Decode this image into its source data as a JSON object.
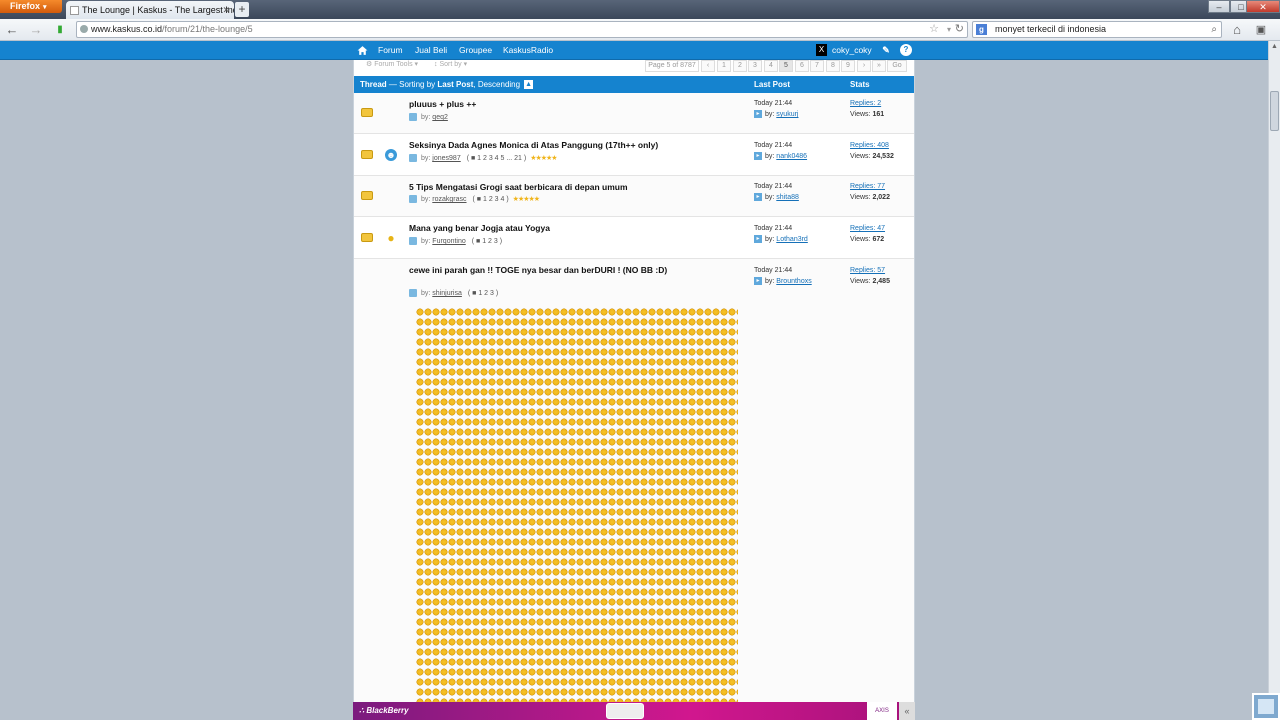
{
  "browser": {
    "menu_button": "Firefox",
    "tab_title": "The Lounge | Kaskus - The Largest Indon...",
    "new_tab": "+",
    "url_domain": "www.kaskus.co.id",
    "url_path": "/forum/21/the-lounge/5",
    "search_engine_glyph": "g",
    "search_query": "monyet terkecil di indonesia",
    "window_buttons": [
      "–",
      "□",
      "✕"
    ]
  },
  "sitenav": {
    "items": [
      "Forum",
      "Jual Beli",
      "Groupee",
      "KaskusRadio"
    ],
    "username": "coky_coky",
    "avatar_glyph": "X"
  },
  "toolbar": {
    "forum_tools": "⚙ Forum Tools ▾",
    "sort_by": "↕ Sort by ▾",
    "page_info": "Page 5 of 8787",
    "prev": "‹",
    "pages": [
      "1",
      "2",
      "3",
      "4",
      "5",
      "6",
      "7",
      "8",
      "9"
    ],
    "current_page": "5",
    "next": "›",
    "last": "»",
    "go": "Go"
  },
  "table_header": {
    "thread_prefix": "Thread",
    "sort_text": " — Sorting by ",
    "sort_field": "Last Post",
    "sort_sep": ", ",
    "sort_dir": "Descending",
    "sort_icon": "▲",
    "last_post": "Last Post",
    "stats": "Stats"
  },
  "threads": [
    {
      "title": "pluuus + plus ++",
      "by_label": "by:",
      "author": "qeq2",
      "pages": "",
      "rating": "",
      "time": "Today 21:44",
      "lp_by_label": "by:",
      "lp_user": "syukurj",
      "replies": "Replies: 2",
      "views_label": "Views:",
      "views": "161",
      "icon": ""
    },
    {
      "title": "Seksinya Dada Agnes Monica di Atas Panggung (17th++ only)",
      "by_label": "by:",
      "author": "jones987",
      "pages": "( ■ 1 2 3 4 5 ... 21 )",
      "rating": "★★★★★",
      "time": "Today 21:44",
      "lp_by_label": "by:",
      "lp_user": "nank0486",
      "replies": "Replies: 408",
      "views_label": "Views:",
      "views": "24,532",
      "icon": "☻"
    },
    {
      "title": "5 Tips Mengatasi Grogi saat berbicara di depan umum",
      "by_label": "by:",
      "author": "rozakgrasc",
      "pages": "( ■ 1 2 3 4 )",
      "rating": "★★★★★",
      "time": "Today 21:44",
      "lp_by_label": "by:",
      "lp_user": "shita88",
      "replies": "Replies: 77",
      "views_label": "Views:",
      "views": "2,022",
      "icon": ""
    },
    {
      "title": "Mana yang benar Jogja atau Yogya",
      "by_label": "by:",
      "author": "Furqontino",
      "pages": "( ■ 1 2 3 )",
      "rating": "",
      "time": "Today 21:44",
      "lp_by_label": "by:",
      "lp_user": "Lothan3rd",
      "replies": "Replies: 47",
      "views_label": "Views:",
      "views": "672",
      "icon": "●"
    },
    {
      "title": "cewe ini parah gan !! TOGE nya besar dan berDURI ! (NO BB :D)",
      "by_label": "by:",
      "author": "shinjurisa",
      "pages": "( ■ 1 2 3 )",
      "rating": "",
      "time": "Today 21:44",
      "lp_by_label": "by:",
      "lp_user": "Brounthoxs",
      "replies": "Replies: 57",
      "views_label": "Views:",
      "views": "2,485",
      "icon": ""
    }
  ],
  "ad": {
    "brand": "BlackBerry",
    "brand_mark": "∴",
    "partner": "AXIS",
    "collapse": "«"
  },
  "colors": {
    "accent": "#1583cf",
    "star": "#f0b51c",
    "ad_magenta": "#d1178e"
  }
}
